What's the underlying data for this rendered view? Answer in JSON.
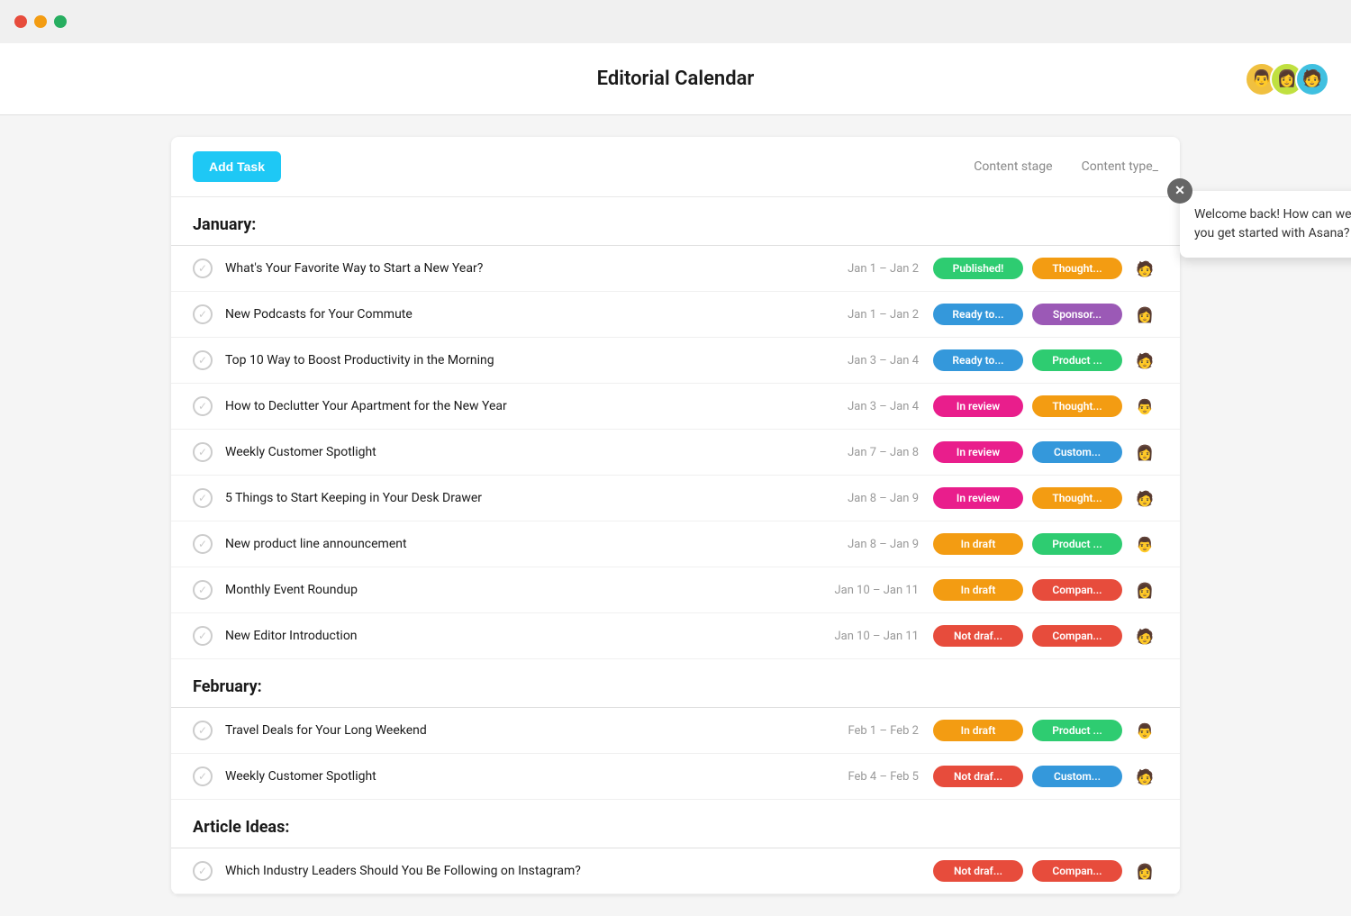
{
  "titleBar": {
    "trafficLights": [
      "red",
      "yellow",
      "green"
    ]
  },
  "header": {
    "title": "Editorial Calendar",
    "avatars": [
      "👨",
      "👩",
      "🧑"
    ]
  },
  "toolbar": {
    "addTaskLabel": "Add Task",
    "contentStageLabel": "Content stage",
    "contentTypeLabel": "Content type_"
  },
  "sections": [
    {
      "name": "January:",
      "tasks": [
        {
          "title": "What's Your Favorite Way to Start a New Year?",
          "date": "Jan 1 – Jan 2",
          "statusLabel": "Published!",
          "statusClass": "badge-published",
          "contentType": "Thought...",
          "contentTypeClass": "ct-thought",
          "avatar": "🧑"
        },
        {
          "title": "New Podcasts for Your Commute",
          "date": "Jan 1 – Jan 2",
          "statusLabel": "Ready to...",
          "statusClass": "badge-ready",
          "contentType": "Sponsor...",
          "contentTypeClass": "ct-sponsor",
          "avatar": "👩"
        },
        {
          "title": "Top 10 Way to Boost Productivity in the Morning",
          "date": "Jan 3 – Jan 4",
          "statusLabel": "Ready to...",
          "statusClass": "badge-ready",
          "contentType": "Product ...",
          "contentTypeClass": "ct-product",
          "avatar": "🧑"
        },
        {
          "title": "How to Declutter Your Apartment for the New Year",
          "date": "Jan 3 – Jan 4",
          "statusLabel": "In review",
          "statusClass": "badge-inreview",
          "contentType": "Thought...",
          "contentTypeClass": "ct-thought",
          "avatar": "👨"
        },
        {
          "title": "Weekly Customer Spotlight",
          "date": "Jan 7 – Jan 8",
          "statusLabel": "In review",
          "statusClass": "badge-inreview",
          "contentType": "Custom...",
          "contentTypeClass": "ct-custom",
          "avatar": "👩"
        },
        {
          "title": "5 Things to Start Keeping in Your Desk Drawer",
          "date": "Jan 8 – Jan 9",
          "statusLabel": "In review",
          "statusClass": "badge-inreview",
          "contentType": "Thought...",
          "contentTypeClass": "ct-thought",
          "avatar": "🧑"
        },
        {
          "title": "New product line announcement",
          "date": "Jan 8 – Jan 9",
          "statusLabel": "In draft",
          "statusClass": "badge-indraft",
          "contentType": "Product ...",
          "contentTypeClass": "ct-product",
          "avatar": "👨"
        },
        {
          "title": "Monthly Event Roundup",
          "date": "Jan 10 – Jan 11",
          "statusLabel": "In draft",
          "statusClass": "badge-indraft",
          "contentType": "Compan...",
          "contentTypeClass": "ct-company",
          "avatar": "👩"
        },
        {
          "title": "New Editor Introduction",
          "date": "Jan 10 – Jan 11",
          "statusLabel": "Not draf...",
          "statusClass": "badge-notdraft",
          "contentType": "Compan...",
          "contentTypeClass": "ct-company",
          "avatar": "🧑"
        }
      ]
    },
    {
      "name": "February:",
      "tasks": [
        {
          "title": "Travel Deals for Your Long Weekend",
          "date": "Feb 1 – Feb 2",
          "statusLabel": "In draft",
          "statusClass": "badge-indraft",
          "contentType": "Product ...",
          "contentTypeClass": "ct-product",
          "avatar": "👨"
        },
        {
          "title": "Weekly Customer Spotlight",
          "date": "Feb 4 – Feb 5",
          "statusLabel": "Not draf...",
          "statusClass": "badge-notdraft",
          "contentType": "Custom...",
          "contentTypeClass": "ct-custom",
          "avatar": "🧑"
        }
      ]
    },
    {
      "name": "Article Ideas:",
      "tasks": [
        {
          "title": "Which Industry Leaders Should You Be Following on Instagram?",
          "date": "",
          "statusLabel": "Not draf...",
          "statusClass": "badge-notdraft",
          "contentType": "Compan...",
          "contentTypeClass": "ct-company",
          "avatar": "👩"
        }
      ]
    }
  ],
  "chatPopup": {
    "message": "Welcome back! How can we help you get started with Asana?"
  }
}
